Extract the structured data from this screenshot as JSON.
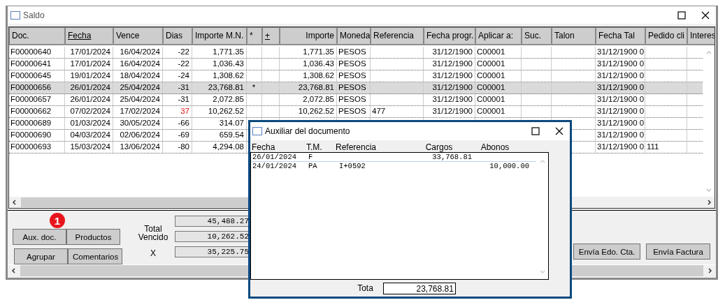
{
  "window": {
    "title": "Saldo"
  },
  "table": {
    "columns": [
      {
        "label": "Doc.",
        "underlined": false
      },
      {
        "label": "Fecha",
        "underlined": true
      },
      {
        "label": "Vence",
        "underlined": false
      },
      {
        "label": "Dias",
        "underlined": false
      },
      {
        "label": "Importe M.N.",
        "underlined": false
      },
      {
        "label": "*",
        "underlined": false
      },
      {
        "label": "+",
        "underlined": true
      },
      {
        "label": "Importe",
        "underlined": false
      },
      {
        "label": "Moneda",
        "underlined": false
      },
      {
        "label": "Referencia",
        "underlined": false
      },
      {
        "label": "Fecha progr.",
        "underlined": false
      },
      {
        "label": "Aplicar a:",
        "underlined": false
      },
      {
        "label": "Suc.",
        "underlined": false
      },
      {
        "label": "Talon",
        "underlined": false
      },
      {
        "label": "Fecha Tal",
        "underlined": false
      },
      {
        "label": "Pedido cli",
        "underlined": false
      },
      {
        "label": "Interes",
        "underlined": false
      }
    ],
    "rows": [
      {
        "selected": false,
        "overdue": false,
        "cells": [
          "F00000640",
          "17/01/2024",
          "16/04/2024",
          "-22",
          "1,771.35",
          null,
          null,
          "1,771.35",
          "PESOS",
          null,
          "31/12/1900",
          "C00001",
          null,
          null,
          "31/12/1900 0",
          null,
          null
        ]
      },
      {
        "selected": false,
        "overdue": false,
        "cells": [
          "F00000641",
          "17/01/2024",
          "16/04/2024",
          "-22",
          "1,036.43",
          null,
          null,
          "1,036.43",
          "PESOS",
          null,
          "31/12/1900",
          "C00001",
          null,
          null,
          "31/12/1900 0",
          null,
          null
        ]
      },
      {
        "selected": false,
        "overdue": false,
        "cells": [
          "F00000645",
          "19/01/2024",
          "18/04/2024",
          "-24",
          "1,308.62",
          null,
          null,
          "1,308.62",
          "PESOS",
          null,
          "31/12/1900",
          "C00001",
          null,
          null,
          "31/12/1900 0",
          null,
          null
        ]
      },
      {
        "selected": true,
        "overdue": false,
        "cells": [
          "F00000656",
          "26/01/2024",
          "25/04/2024",
          "-31",
          "23,768.81",
          "*",
          null,
          "23,768.81",
          "PESOS",
          null,
          "31/12/1900",
          "C00001",
          null,
          null,
          "31/12/1900 0",
          null,
          null
        ]
      },
      {
        "selected": false,
        "overdue": false,
        "cells": [
          "F00000657",
          "26/01/2024",
          "25/04/2024",
          "-31",
          "2,072.85",
          null,
          null,
          "2,072.85",
          "PESOS",
          null,
          "31/12/1900",
          "C00001",
          null,
          null,
          "31/12/1900 0",
          null,
          null
        ]
      },
      {
        "selected": false,
        "overdue": true,
        "cells": [
          "F00000662",
          "07/02/2024",
          "17/02/2024",
          "37",
          "10,262.52",
          null,
          null,
          "10,262.52",
          "PESOS",
          "477",
          "31/12/1900",
          "C00001",
          null,
          null,
          "31/12/1900 0",
          null,
          null
        ]
      },
      {
        "selected": false,
        "overdue": false,
        "cells": [
          "F00000689",
          "01/03/2024",
          "30/05/2024",
          "-66",
          "314.07",
          null,
          null,
          null,
          null,
          null,
          null,
          null,
          null,
          null,
          "31/12/1900 0",
          null,
          null
        ]
      },
      {
        "selected": false,
        "overdue": false,
        "cells": [
          "F00000690",
          "04/03/2024",
          "02/06/2024",
          "-69",
          "659.54",
          null,
          null,
          null,
          null,
          null,
          null,
          null,
          null,
          null,
          "31/12/1900 0",
          null,
          null
        ]
      },
      {
        "selected": false,
        "overdue": false,
        "cells": [
          "F00000693",
          "15/03/2024",
          "13/06/2024",
          "-80",
          "4,294.08",
          null,
          null,
          null,
          null,
          null,
          null,
          null,
          null,
          null,
          "31/12/1900 0",
          "111",
          null
        ]
      }
    ]
  },
  "buttons_left": [
    [
      "Aux. doc.",
      "Productos"
    ],
    [
      "Agrupar",
      "Comentarios"
    ]
  ],
  "badge": "1",
  "totals": {
    "labels": [
      "Total",
      "Vencido",
      "X"
    ],
    "values": [
      "45,488.27",
      "10,262.52",
      "35,225.75"
    ]
  },
  "buttons_right": [
    "Envía Edo. Cta.",
    "Envía Factura"
  ],
  "dialog": {
    "title": "Auxiliar del documento",
    "columns": [
      "Fecha",
      "T.M.",
      "Referencia",
      "Cargos",
      "Abonos"
    ],
    "rows": [
      {
        "selected": true,
        "cells": [
          "26/01/2024",
          "F",
          null,
          "33,768.81",
          null
        ]
      },
      {
        "selected": false,
        "cells": [
          "24/01/2024",
          "PA",
          "I+0592",
          null,
          "10,000.00"
        ]
      }
    ],
    "total_label": "Tota",
    "total_value": "23,768.81"
  }
}
